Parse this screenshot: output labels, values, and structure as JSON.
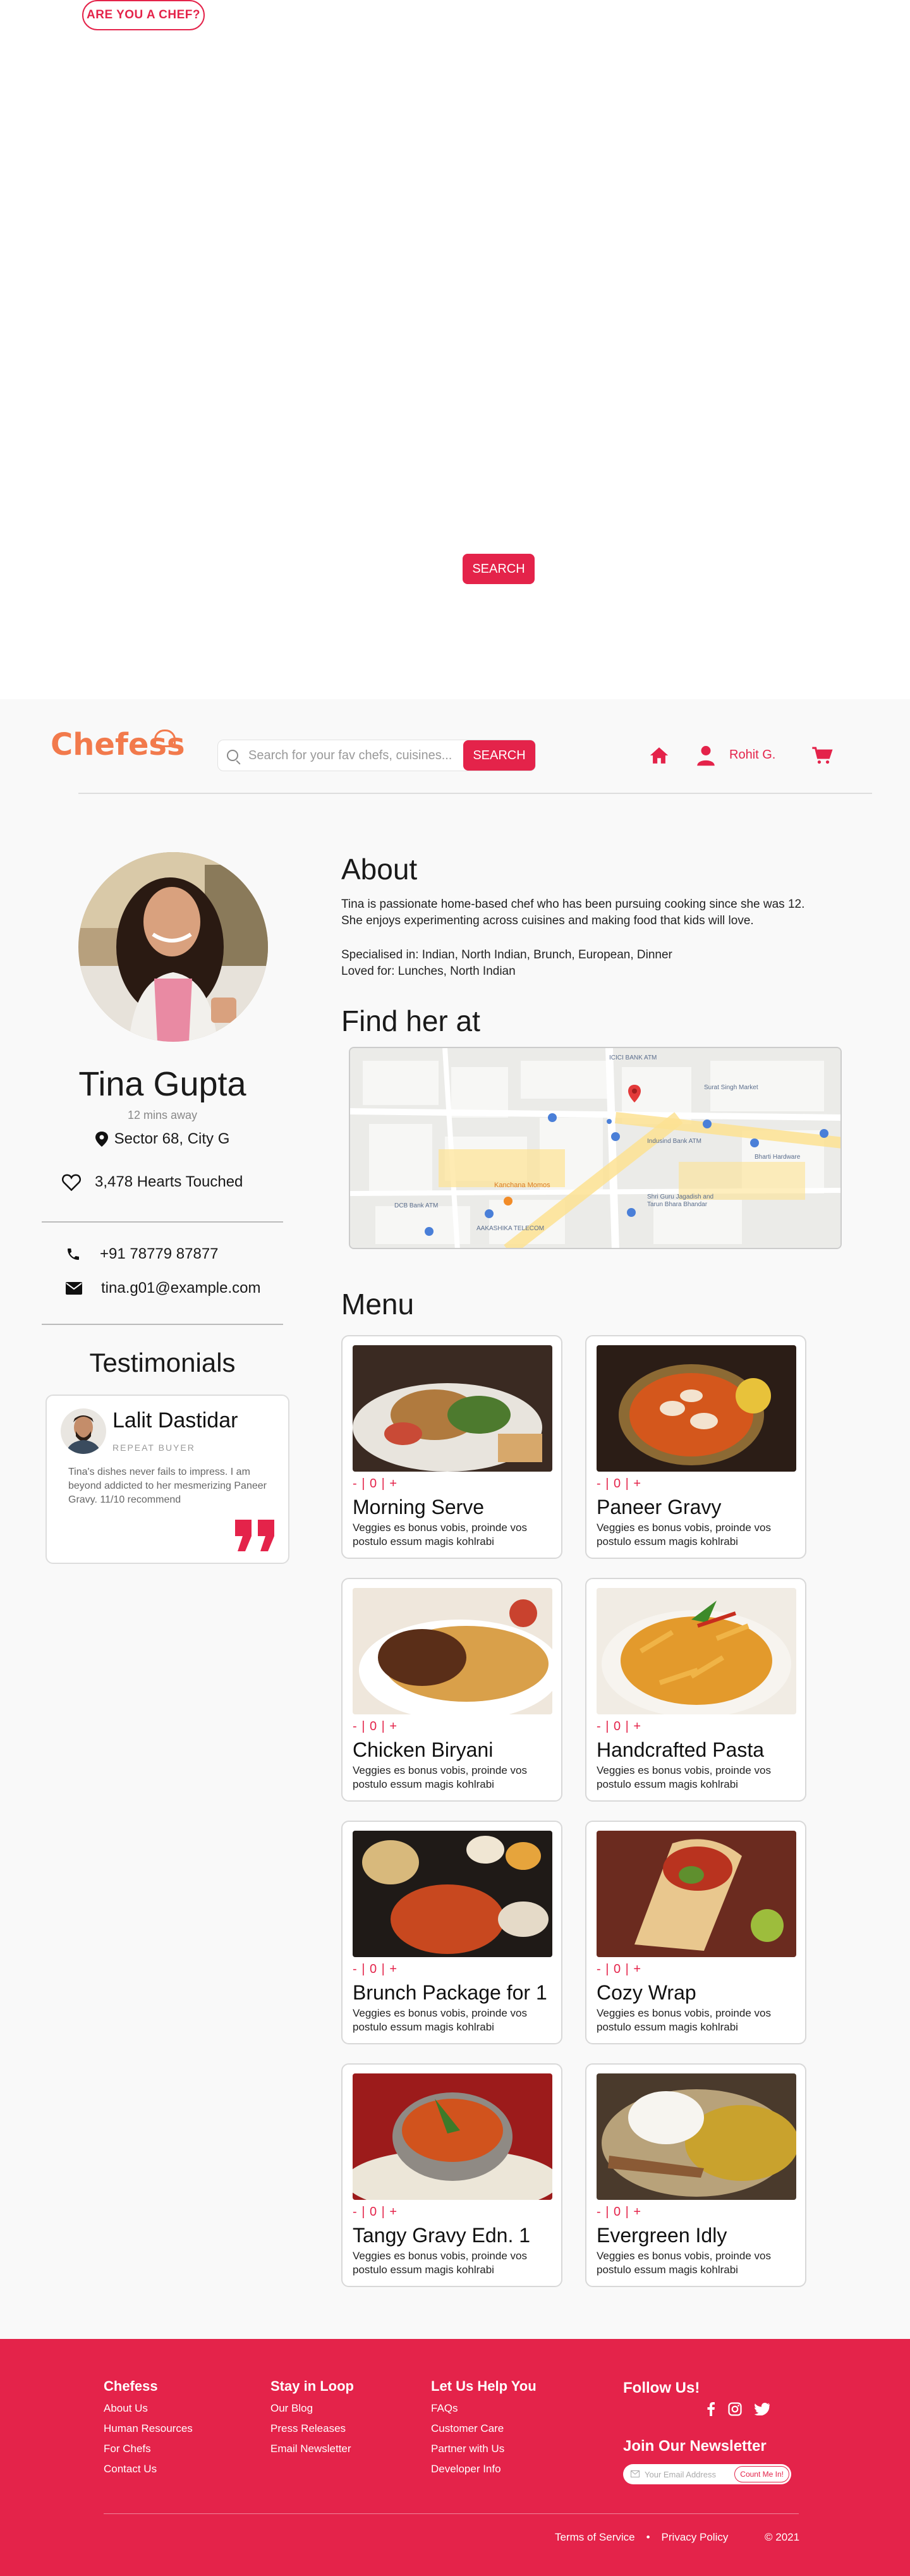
{
  "hero": {
    "chef_button": "ARE YOU A CHEF?",
    "search_button": "SEARCH"
  },
  "header": {
    "logo": "Chefess",
    "search_placeholder": "Search for your fav chefs, cuisines...",
    "search_button": "SEARCH",
    "user_name": "Rohit G."
  },
  "chef": {
    "name": "Tina Gupta",
    "distance": "12 mins away",
    "location": "Sector 68, City G",
    "hearts": "3,478 Hearts Touched",
    "phone": "+91 78779 87877",
    "email": "tina.g01@example.com"
  },
  "testimonials": {
    "heading": "Testimonials",
    "name": "Lalit Dastidar",
    "role": "REPEAT BUYER",
    "text": "Tina's dishes never fails to impress. I am beyond addicted to her mesmerizing Paneer Gravy. 11/10 recommend"
  },
  "about": {
    "heading": "About",
    "bio": "Tina is passionate home-based chef who has been pursuing cooking since she was 12. She enjoys experimenting across cuisines and making food that kids will love.",
    "specialised": "Specialised in: Indian, North Indian, Brunch, European, Dinner",
    "loved": "Loved for: Lunches, North Indian"
  },
  "find": {
    "heading": "Find her at",
    "map_labels": [
      "ICICI BANK ATM",
      "Surat Singh Market",
      "Indusind Bank ATM",
      "Bharti Hardware",
      "Kanchana Momos",
      "Shri Guru Jagadish and Tarun Bhara Bhandar",
      "DCB Bank ATM",
      "AAKASHIKA TELECOM"
    ]
  },
  "menu": {
    "heading": "Menu",
    "qty_label": "- | 0 | +",
    "items": [
      {
        "name": "Morning Serve",
        "desc": "Veggies es bonus vobis, proinde vos postulo essum magis kohlrabi"
      },
      {
        "name": "Paneer Gravy",
        "desc": "Veggies es bonus vobis, proinde vos postulo essum magis kohlrabi"
      },
      {
        "name": "Chicken Biryani",
        "desc": "Veggies es bonus vobis, proinde vos postulo essum magis kohlrabi"
      },
      {
        "name": "Handcrafted Pasta",
        "desc": "Veggies es bonus vobis, proinde vos postulo essum magis kohlrabi"
      },
      {
        "name": "Brunch Package for 1",
        "desc": "Veggies es bonus vobis, proinde vos postulo essum magis kohlrabi"
      },
      {
        "name": "Cozy Wrap",
        "desc": "Veggies es bonus vobis, proinde vos postulo essum magis kohlrabi"
      },
      {
        "name": "Tangy Gravy Edn. 1",
        "desc": "Veggies es bonus vobis, proinde vos postulo essum magis kohlrabi"
      },
      {
        "name": "Evergreen Idly",
        "desc": "Veggies es bonus vobis, proinde vos postulo essum magis kohlrabi"
      }
    ]
  },
  "footer": {
    "col1": {
      "heading": "Chefess",
      "links": [
        "About Us",
        "Human Resources",
        "For Chefs",
        "Contact Us"
      ]
    },
    "col2": {
      "heading": "Stay in Loop",
      "links": [
        "Our Blog",
        "Press Releases",
        "Email Newsletter"
      ]
    },
    "col3": {
      "heading": "Let Us Help You",
      "links": [
        "FAQs",
        "Customer Care",
        "Partner with Us",
        "Developer Info"
      ]
    },
    "follow": "Follow Us!",
    "newsletter_heading": "Join Our Newsletter",
    "newsletter_placeholder": "Your Email Address",
    "newsletter_button": "Count Me In!",
    "terms": "Terms of Service",
    "dot": "•",
    "privacy": "Privacy Policy",
    "copyright": "© 2021"
  },
  "colors": {
    "accent": "#e4234a",
    "logo": "#f27a4c",
    "page_bg": "#f9f9f9"
  },
  "icons": [
    "search-icon",
    "home-icon",
    "user-icon",
    "cart-icon",
    "location-pin-icon",
    "heart-icon",
    "phone-icon",
    "mail-icon",
    "quote-icon",
    "facebook-icon",
    "instagram-icon",
    "twitter-icon"
  ]
}
